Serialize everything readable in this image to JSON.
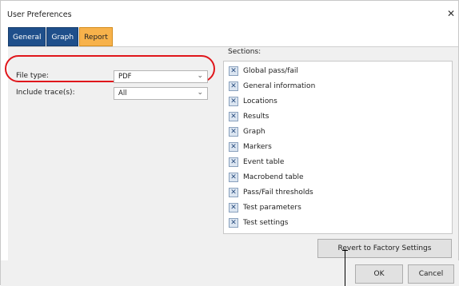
{
  "window": {
    "title": "User Preferences",
    "close_glyph": "✕"
  },
  "tabs": [
    {
      "label": "General",
      "active": false
    },
    {
      "label": "Graph",
      "active": false
    },
    {
      "label": "Report",
      "active": true
    }
  ],
  "report": {
    "file_type": {
      "label": "File type:",
      "value": "PDF"
    },
    "include_traces": {
      "label": "Include trace(s):",
      "value": "All"
    }
  },
  "sections": {
    "label": "Sections:",
    "items": [
      {
        "label": "Global pass/fail",
        "checked": true
      },
      {
        "label": "General information",
        "checked": true
      },
      {
        "label": "Locations",
        "checked": true
      },
      {
        "label": "Results",
        "checked": true
      },
      {
        "label": "Graph",
        "checked": true
      },
      {
        "label": "Markers",
        "checked": true
      },
      {
        "label": "Event table",
        "checked": true
      },
      {
        "label": "Macrobend table",
        "checked": true
      },
      {
        "label": "Pass/Fail thresholds",
        "checked": true
      },
      {
        "label": "Test parameters",
        "checked": true
      },
      {
        "label": "Test settings",
        "checked": true
      }
    ]
  },
  "buttons": {
    "revert": "Revert to Factory Settings",
    "ok": "OK",
    "cancel": "Cancel"
  },
  "icons": {
    "checkbox_mark": "✕",
    "dropdown": "chevron-down-icon"
  },
  "colors": {
    "tab_blue": "#1f4f8b",
    "tab_active": "#f7b24b",
    "highlight": "#e0161b"
  }
}
